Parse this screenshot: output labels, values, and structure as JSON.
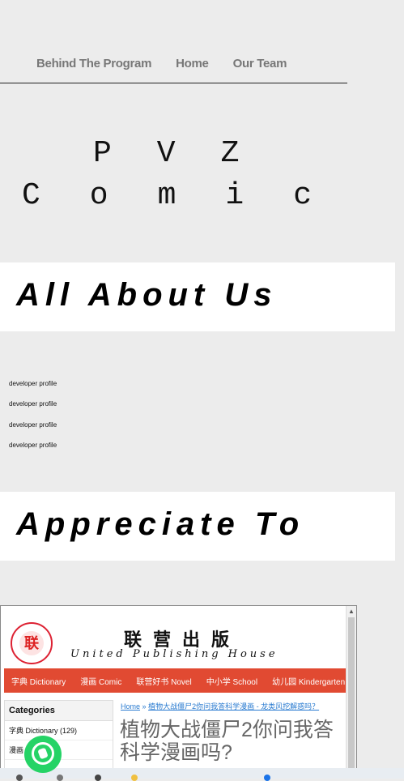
{
  "nav": {
    "items": [
      "Behind The Program",
      "Home",
      "Our Team"
    ]
  },
  "hero": {
    "line1": "PVZ",
    "line2": "Comic"
  },
  "sections": {
    "about": "All About Us",
    "appreciate": "Appreciate To"
  },
  "profiles": [
    "developer profile",
    "developer profile",
    "developer profile",
    "developer profile"
  ],
  "embedded_site": {
    "publisher_cn": "联营出版",
    "publisher_en": "United Publishing House",
    "menu": [
      "字典 Dictionary",
      "漫画 Comic",
      "联营好书 Novel",
      "中小学 School",
      "幼儿园 Kindergarten"
    ],
    "categories_title": "Categories",
    "categories": [
      "字典 Dictionary (129)",
      "漫画 ... (4)"
    ],
    "breadcrumb_home": "Home",
    "breadcrumb_sep": "»",
    "breadcrumb_current": "植物大战僵尸2你问我答科学漫画 - 龙类风挖解惑吗？",
    "title": "植物大战僵尸2你问我答科学漫画吗?"
  },
  "colors": {
    "background": "#ececec",
    "menu_red": "#e14a32",
    "whatsapp_green": "#25d366"
  }
}
